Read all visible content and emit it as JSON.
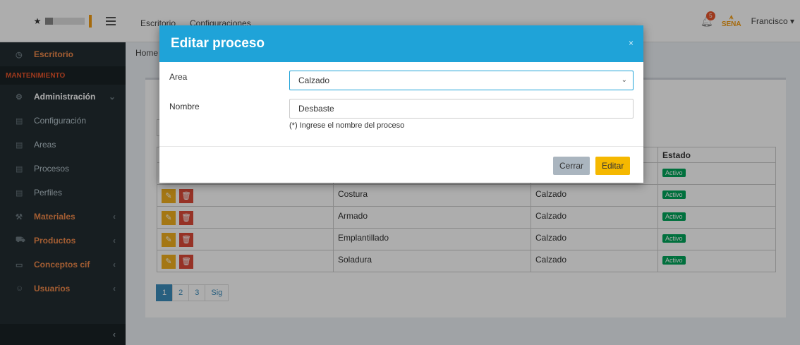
{
  "topbar": {
    "nav": [
      "Escritorio",
      "Configuraciones"
    ],
    "notif_count": "5",
    "brand": "SENA",
    "user": "Francisco ▾"
  },
  "sidebar": {
    "items": [
      {
        "label": "Escritorio",
        "icon": "clock-icon",
        "style": "orange"
      },
      {
        "header": "MANTENIMIENTO"
      },
      {
        "label": "Administración",
        "icon": "gear-icon",
        "style": "white"
      },
      {
        "label": "Configuración",
        "icon": "list-icon",
        "style": "normal"
      },
      {
        "label": "Areas",
        "icon": "list-icon",
        "style": "normal"
      },
      {
        "label": "Procesos",
        "icon": "list-icon",
        "style": "normal"
      },
      {
        "label": "Perfiles",
        "icon": "list-icon",
        "style": "normal"
      },
      {
        "label": "Materiales",
        "icon": "wrench-icon",
        "style": "orange"
      },
      {
        "label": "Productos",
        "icon": "cart-icon",
        "style": "orange"
      },
      {
        "label": "Conceptos cif",
        "icon": "monitor-icon",
        "style": "orange"
      },
      {
        "label": "Usuarios",
        "icon": "user-icon",
        "style": "orange"
      }
    ],
    "collapse": "‹"
  },
  "content": {
    "breadcrumb": "Home",
    "table": {
      "header_estado": "Estado",
      "rows": [
        {
          "nombre": "",
          "area": "",
          "estado": "Activo"
        },
        {
          "nombre": "Costura",
          "area": "Calzado",
          "estado": "Activo"
        },
        {
          "nombre": "Armado",
          "area": "Calzado",
          "estado": "Activo"
        },
        {
          "nombre": "Emplantillado",
          "area": "Calzado",
          "estado": "Activo"
        },
        {
          "nombre": "Soladura",
          "area": "Calzado",
          "estado": "Activo"
        }
      ]
    },
    "pager": [
      "1",
      "2",
      "3",
      "Sig"
    ]
  },
  "modal": {
    "title": "Editar proceso",
    "close": "×",
    "area_label": "Area",
    "area_value": "Calzado",
    "nombre_label": "Nombre",
    "nombre_value": "Desbaste",
    "hint": "(*) Ingrese el nombre del proceso",
    "btn_cerrar": "Cerrar",
    "btn_editar": "Editar"
  },
  "colors": {
    "modal_header": "#1fa3d8",
    "sidebar_bg": "#222d32",
    "accent_orange": "#f08a4b",
    "edit_button": "#f5b800"
  }
}
